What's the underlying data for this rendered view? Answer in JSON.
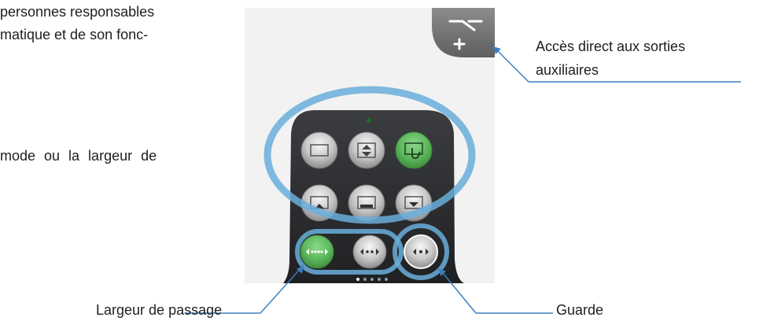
{
  "text": {
    "line1": "personnes responsables",
    "line2": "matique et de son fonc-",
    "line3": "mode ou la largeur de"
  },
  "callouts": {
    "aux_line1": "Accès direct aux sorties",
    "aux_line2": "auxiliaires",
    "largeur": "Largeur de passage",
    "guarde": "Guarde"
  },
  "colors": {
    "callout_blue": "#3a7fc0",
    "ring_blue": "#6aaedb",
    "remote_dark": "#2d2f31",
    "green_active": "#5cb85c"
  },
  "remote": {
    "buttons": [
      {
        "icon": "open-mode-icon",
        "active": false
      },
      {
        "icon": "adjust-up-down-icon",
        "active": false
      },
      {
        "icon": "manual-hand-icon",
        "active": true
      },
      {
        "icon": "exit-only-icon",
        "active": false
      },
      {
        "icon": "closed-mode-icon",
        "active": false
      },
      {
        "icon": "entry-only-icon",
        "active": false
      },
      {
        "icon": "full-width-icon",
        "active": true
      },
      {
        "icon": "reduced-width-icon",
        "active": false
      },
      {
        "icon": "guard-icon",
        "active": false
      }
    ],
    "page_dots": 5,
    "active_page": 0
  }
}
